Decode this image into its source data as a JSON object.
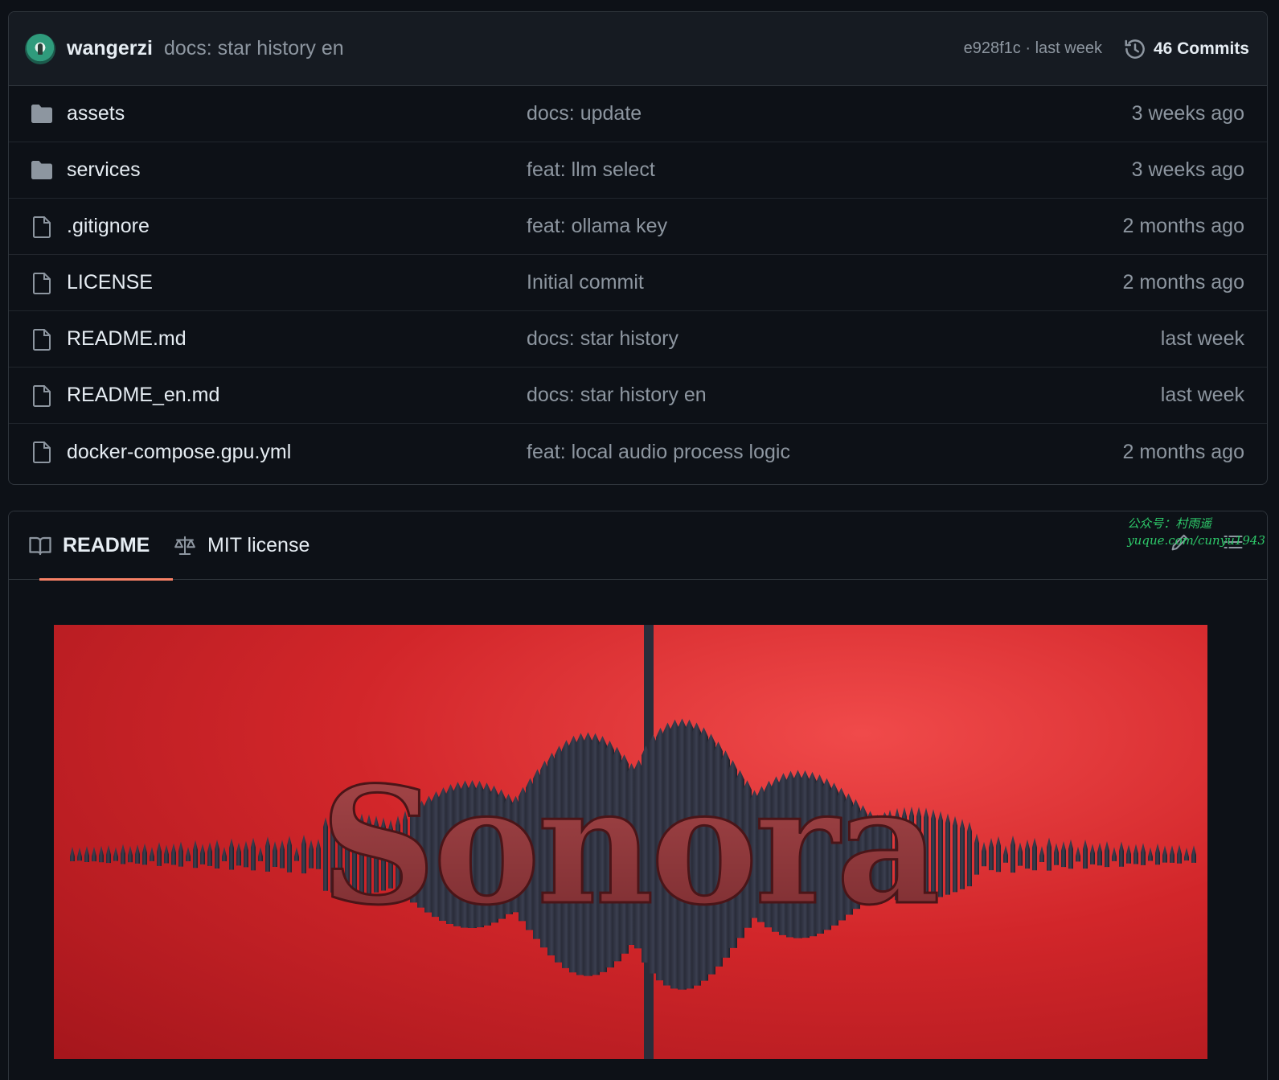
{
  "commit_bar": {
    "author": "wangerzi",
    "message": "docs: star history en",
    "hash_time": "e928f1c · last week",
    "commits_label": "46 Commits"
  },
  "files": [
    {
      "name": "assets",
      "type": "folder",
      "commit": "docs: update",
      "time": "3 weeks ago"
    },
    {
      "name": "services",
      "type": "folder",
      "commit": "feat: llm select",
      "time": "3 weeks ago"
    },
    {
      "name": ".gitignore",
      "type": "file",
      "commit": "feat: ollama key",
      "time": "2 months ago"
    },
    {
      "name": "LICENSE",
      "type": "file",
      "commit": "Initial commit",
      "time": "2 months ago"
    },
    {
      "name": "README.md",
      "type": "file",
      "commit": "docs: star history",
      "time": "last week"
    },
    {
      "name": "README_en.md",
      "type": "file",
      "commit": "docs: star history en",
      "time": "last week"
    },
    {
      "name": "docker-compose.gpu.yml",
      "type": "file",
      "commit": "feat: local audio process logic",
      "time": "2 months ago"
    }
  ],
  "readme": {
    "tabs": [
      {
        "label": "README",
        "icon": "book-icon",
        "active": true
      },
      {
        "label": "MIT license",
        "icon": "scale-icon",
        "active": false
      }
    ],
    "watermark": {
      "line1": "公众号：村雨遥",
      "line2": "yuque.com/cunyu1943"
    },
    "banner_title": "Sonora"
  },
  "colors": {
    "background": "#0d1117",
    "header_bg": "#161b22",
    "border": "#30363d",
    "text": "#e6edf3",
    "muted": "#8d96a0",
    "tab_accent": "#f78166",
    "banner_red": "#d2262a"
  }
}
